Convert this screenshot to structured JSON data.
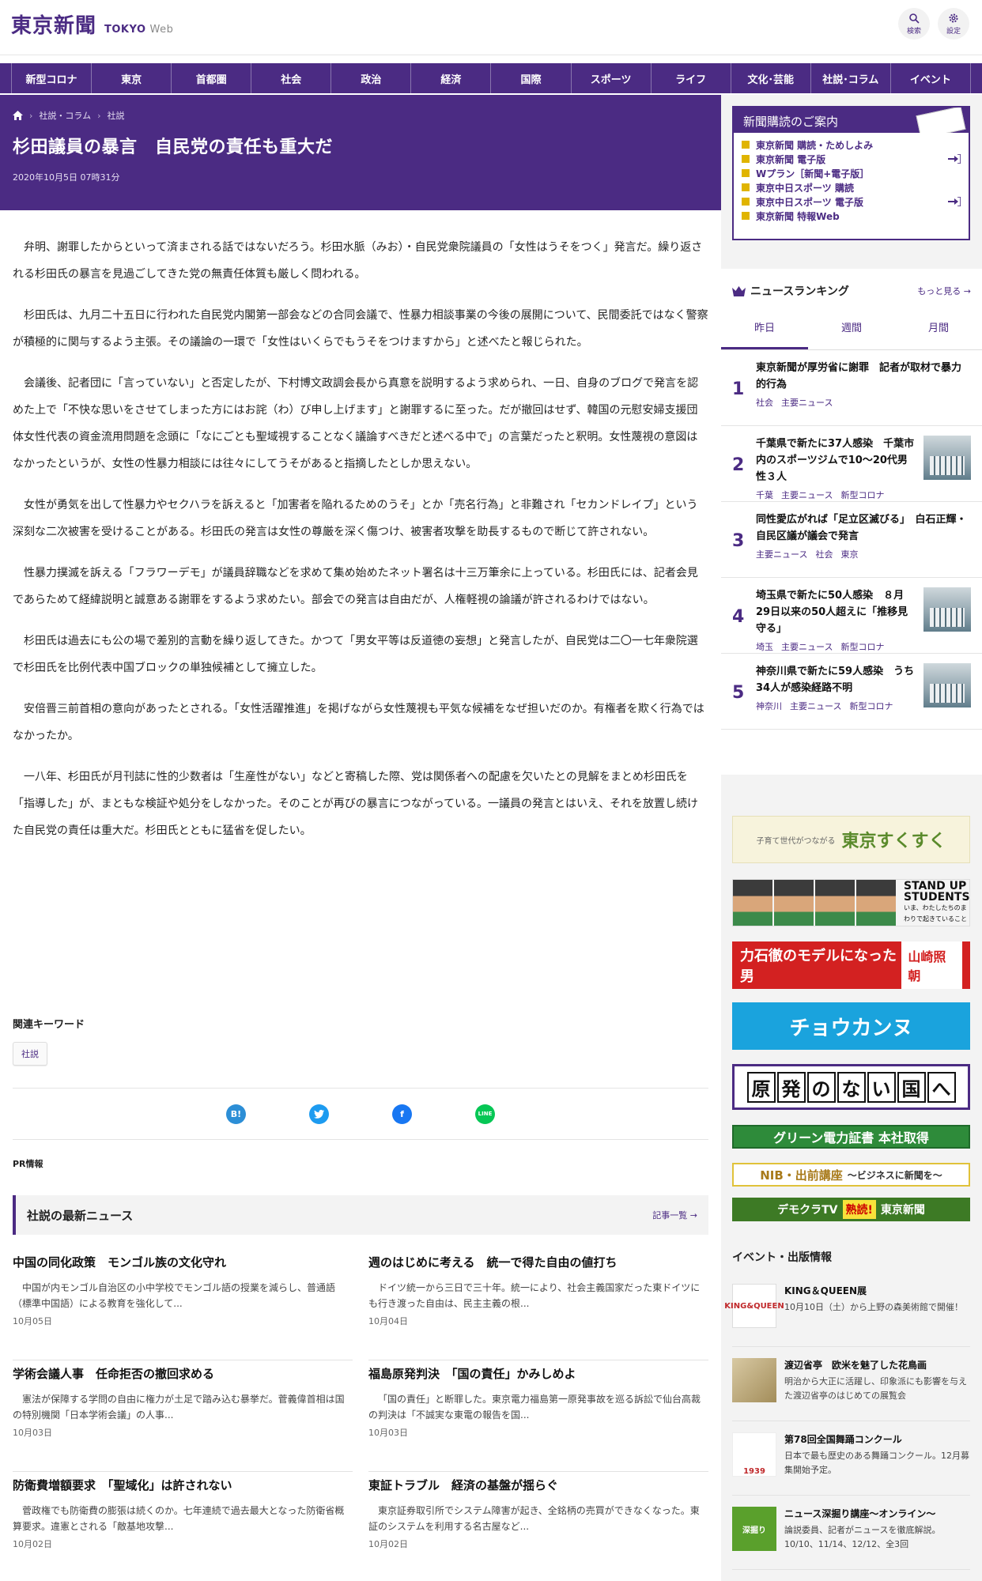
{
  "header": {
    "logo_jp": "東京新聞",
    "logo_en": "TOKYO",
    "logo_web": "Web",
    "search_label": "検索",
    "settings_label": "設定"
  },
  "nav": [
    "新型コロナ",
    "東京",
    "首都圏",
    "社会",
    "政治",
    "経済",
    "国際",
    "スポーツ",
    "ライフ",
    "文化･芸能",
    "社説･コラム",
    "イベント"
  ],
  "breadcrumb": [
    "社説・コラム",
    "社説"
  ],
  "article": {
    "title": "杉田議員の暴言　自民党の責任も重大だ",
    "date": "2020年10月5日 07時31分",
    "paragraphs": [
      "弁明、謝罪したからといって済まされる話ではないだろう。杉田水脈（みお）・自民党衆院議員の「女性はうそをつく」発言だ。繰り返される杉田氏の暴言を見過ごしてきた党の無責任体質も厳しく問われる。",
      "杉田氏は、九月二十五日に行われた自民党内閣第一部会などの合同会議で、性暴力相談事業の今後の展開について、民間委託ではなく警察が積極的に関与するよう主張。その議論の一環で「女性はいくらでもうそをつけますから」と述べたと報じられた。",
      "会議後、記者団に「言っていない」と否定したが、下村博文政調会長から真意を説明するよう求められ、一日、自身のブログで発言を認めた上で「不快な思いをさせてしまった方にはお詫（わ）び申し上げます」と謝罪するに至った。だが撤回はせず、韓国の元慰安婦支援団体女性代表の資金流用問題を念頭に「なにごとも聖域視することなく議論すべきだと述べる中で」の言葉だったと釈明。女性蔑視の意図はなかったというが、女性の性暴力相談には往々にしてうそがあると指摘したとしか思えない。",
      "女性が勇気を出して性暴力やセクハラを訴えると「加害者を陥れるためのうそ」とか「売名行為」と非難され「セカンドレイプ」という深刻な二次被害を受けることがある。杉田氏の発言は女性の尊厳を深く傷つけ、被害者攻撃を助長するもので断じて許されない。",
      "性暴力撲滅を訴える「フラワーデモ」が議員辞職などを求めて集め始めたネット署名は十三万筆余に上っている。杉田氏には、記者会見であらためて経緯説明と誠意ある謝罪をするよう求めたい。部会での発言は自由だが、人権軽視の論議が許されるわけではない。",
      "杉田氏は過去にも公の場で差別的言動を繰り返してきた。かつて「男女平等は反道徳の妄想」と発言したが、自民党は二〇一七年衆院選で杉田氏を比例代表中国ブロックの単独候補として擁立した。",
      "安倍晋三前首相の意向があったとされる。「女性活躍推進」を掲げながら女性蔑視も平気な候補をなぜ担いだのか。有権者を欺く行為ではなかったか。",
      "一八年、杉田氏が月刊誌に性的少数者は「生産性がない」などと寄稿した際、党は関係者への配慮を欠いたとの見解をまとめ杉田氏を「指導した」が、まともな検証や処分をしなかった。そのことが再びの暴言につながっている。一議員の発言とはいえ、それを放置し続けた自民党の責任は重大だ。杉田氏とともに猛省を促したい。"
    ]
  },
  "keywords": {
    "title": "関連キーワード",
    "tag": "社説"
  },
  "share": [
    "B!",
    "t",
    "f",
    "LINE"
  ],
  "pr_label": "PR情報",
  "latest": {
    "title": "社説の最新ニュース",
    "more": "記事一覧",
    "items": [
      {
        "headline": "中国の同化政策　モンゴル族の文化守れ",
        "summary": "中国が内モンゴル自治区の小中学校でモンゴル語の授業を減らし、普通語（標準中国語）による教育を強化して...",
        "date": "10月05日"
      },
      {
        "headline": "週のはじめに考える　統一で得た自由の値打ち",
        "summary": "ドイツ統一から三日で三十年。統一により、社会主義国家だった東ドイツにも行き渡った自由は、民主主義の根...",
        "date": "10月04日"
      },
      {
        "headline": "学術会議人事　任命拒否の撤回求める",
        "summary": "憲法が保障する学問の自由に権力が土足で踏み込む暴挙だ。菅義偉首相は国の特別機関「日本学術会議」の人事...",
        "date": "10月03日"
      },
      {
        "headline": "福島原発判決　「国の責任」かみしめよ",
        "summary": "「国の責任」と断罪した。東京電力福島第一原発事故を巡る訴訟で仙台高裁の判決は「不誠実な東電の報告を国...",
        "date": "10月03日"
      },
      {
        "headline": "防衛費増額要求　「聖域化」は許されない",
        "summary": "菅政権でも防衛費の膨張は続くのか。七年連続で過去最大となった防衛省概算要求。違憲とされる「敵基地攻撃...",
        "date": "10月02日"
      },
      {
        "headline": "東証トラブル　経済の基盤が揺らぐ",
        "summary": "東京証券取引所でシステム障害が起き、全銘柄の売買ができなくなった。東証のシステムを利用する名古屋など...",
        "date": "10月02日"
      }
    ]
  },
  "subscribe": {
    "title": "新聞購読のご案内",
    "items": [
      {
        "label": "東京新聞 購読・ためしよみ",
        "login": false
      },
      {
        "label": "東京新聞 電子版",
        "login": true
      },
      {
        "label": "Wプラン［新聞+電子版］",
        "login": false
      },
      {
        "label": "東京中日スポーツ 購読",
        "login": false
      },
      {
        "label": "東京中日スポーツ 電子版",
        "login": true
      },
      {
        "label": "東京新聞 特報Web",
        "login": false
      }
    ]
  },
  "ranking": {
    "title": "ニュースランキング",
    "more": "もっと見る",
    "tabs": [
      "昨日",
      "週間",
      "月間"
    ],
    "items": [
      {
        "rank": "1",
        "title": "東京新聞が厚労省に謝罪　記者が取材で暴力的行為",
        "tags": [
          "社会",
          "主要ニュース"
        ],
        "thumb": false
      },
      {
        "rank": "2",
        "title": "千葉県で新たに37人感染　千葉市内のスポーツジムで10～20代男性３人",
        "tags": [
          "千葉",
          "主要ニュース",
          "新型コロナ"
        ],
        "thumb": true
      },
      {
        "rank": "3",
        "title": "同性愛広がれば「足立区滅びる」　白石正輝・自民区議が議会で発言",
        "tags": [
          "主要ニュース",
          "社会",
          "東京"
        ],
        "thumb": false
      },
      {
        "rank": "4",
        "title": "埼玉県で新たに50人感染　８月29日以来の50人超えに「推移見守る」",
        "tags": [
          "埼玉",
          "主要ニュース",
          "新型コロナ"
        ],
        "thumb": true
      },
      {
        "rank": "5",
        "title": "神奈川県で新たに59人感染　うち34人が感染経路不明",
        "tags": [
          "神奈川",
          "主要ニュース",
          "新型コロナ"
        ],
        "thumb": true
      }
    ]
  },
  "banners": {
    "b1_small": "子育て世代がつながる",
    "b1_main": "東京すくすく",
    "b2_main": "STAND UP STUDENTS",
    "b2_small": "いま、わたしたちのまわりで起きていること",
    "b3_left": "力石徹のモデルになった男",
    "b3_right": "山崎照朝",
    "b4": "チョウカンヌ",
    "b5": [
      "原",
      "発",
      "の",
      "な",
      "い",
      "国",
      "へ"
    ],
    "b6": "グリーン電力証書 本社取得",
    "b7_main": "NIB・出前講座",
    "b7_small": "～ビジネスに新聞を～",
    "b8_a": "デモクラTV",
    "b8_b": "熟読!",
    "b8_c": "東京新聞"
  },
  "events": {
    "title": "イベント・出版情報",
    "items": [
      {
        "title": "KING＆QUEEN展",
        "desc": "10月10日（土）から上野の森美術館で開催！",
        "thumb": "KING&QUEEN"
      },
      {
        "title": "渡辺省亭　欧米を魅了した花鳥画",
        "desc": "明治から大正に活躍し、印象派にも影響を与えた渡辺省亭のはじめての展覧会",
        "thumb": ""
      },
      {
        "title": "第78回全国舞踊コンクール",
        "desc": "日本で最も歴史のある舞踊コンクール。12月募集開始予定。",
        "thumb": "1939"
      },
      {
        "title": "ニュース深掘り講座～オンライン～",
        "desc": "論説委員、記者がニュースを徹底解説。10/10、11/14、12/12、全3回",
        "thumb": "深掘り"
      }
    ]
  }
}
